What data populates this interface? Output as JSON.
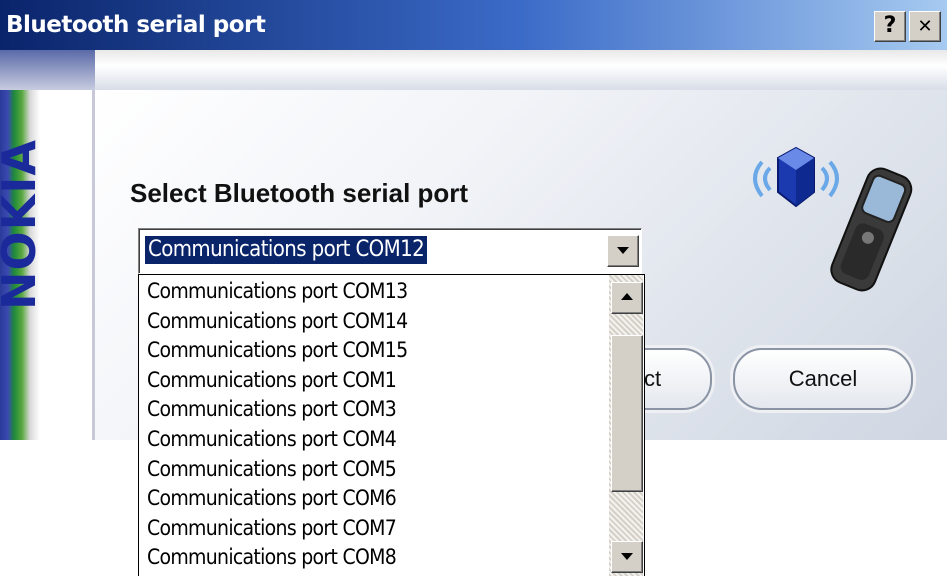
{
  "window": {
    "title": "Bluetooth serial port",
    "help_label": "?",
    "close_label": "✕"
  },
  "brand": {
    "logo_text": "NOKIA"
  },
  "main": {
    "heading": "Select Bluetooth serial port",
    "graphic_icons": [
      "bluetooth-icon",
      "mobile-phone-icon"
    ]
  },
  "combobox": {
    "selected_value": "Communications port COM12",
    "options": [
      "Communications port COM13",
      "Communications port COM14",
      "Communications port COM15",
      "Communications port COM1",
      "Communications port COM3",
      "Communications port COM4",
      "Communications port COM5",
      "Communications port COM6",
      "Communications port COM7",
      "Communications port COM8"
    ]
  },
  "buttons": {
    "select_partial_label": "ct",
    "cancel_label": "Cancel"
  },
  "colors": {
    "titlebar_start": "#0a246a",
    "titlebar_end": "#a6caf0",
    "selection": "#0a246a",
    "nokia_blue": "#1a2a9a"
  }
}
